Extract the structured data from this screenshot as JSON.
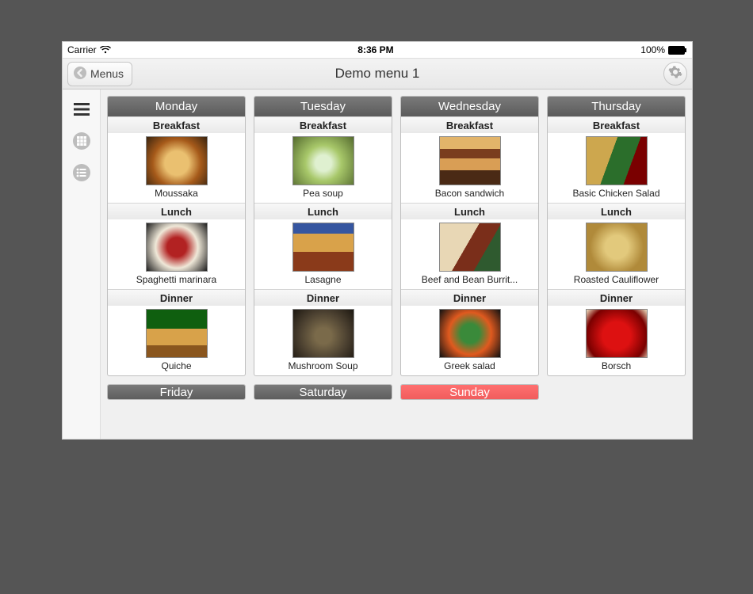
{
  "status": {
    "carrier": "Carrier",
    "time": "8:36 PM",
    "battery": "100%"
  },
  "nav": {
    "back": "Menus",
    "title": "Demo menu 1"
  },
  "days": [
    {
      "name": "Monday",
      "meals": [
        {
          "slot": "Breakfast",
          "dish": "Moussaka",
          "img": "food-moussaka"
        },
        {
          "slot": "Lunch",
          "dish": "Spaghetti marinara",
          "img": "food-spaghetti"
        },
        {
          "slot": "Dinner",
          "dish": "Quiche",
          "img": "food-quiche"
        }
      ]
    },
    {
      "name": "Tuesday",
      "meals": [
        {
          "slot": "Breakfast",
          "dish": "Pea soup",
          "img": "food-pea"
        },
        {
          "slot": "Lunch",
          "dish": "Lasagne",
          "img": "food-lasagne"
        },
        {
          "slot": "Dinner",
          "dish": "Mushroom Soup",
          "img": "food-mushroom"
        }
      ]
    },
    {
      "name": "Wednesday",
      "meals": [
        {
          "slot": "Breakfast",
          "dish": "Bacon sandwich",
          "img": "food-bacon"
        },
        {
          "slot": "Lunch",
          "dish": "Beef and Bean Burrit...",
          "img": "food-burrito"
        },
        {
          "slot": "Dinner",
          "dish": "Greek salad",
          "img": "food-greek"
        }
      ]
    },
    {
      "name": "Thursday",
      "meals": [
        {
          "slot": "Breakfast",
          "dish": "Basic Chicken Salad",
          "img": "food-chicken"
        },
        {
          "slot": "Lunch",
          "dish": "Roasted Cauliflower",
          "img": "food-cauliflower"
        },
        {
          "slot": "Dinner",
          "dish": "Borsch",
          "img": "food-borsch"
        }
      ]
    }
  ],
  "next_row": [
    {
      "name": "Friday",
      "class": ""
    },
    {
      "name": "Saturday",
      "class": ""
    },
    {
      "name": "Sunday",
      "class": "sunday"
    }
  ]
}
